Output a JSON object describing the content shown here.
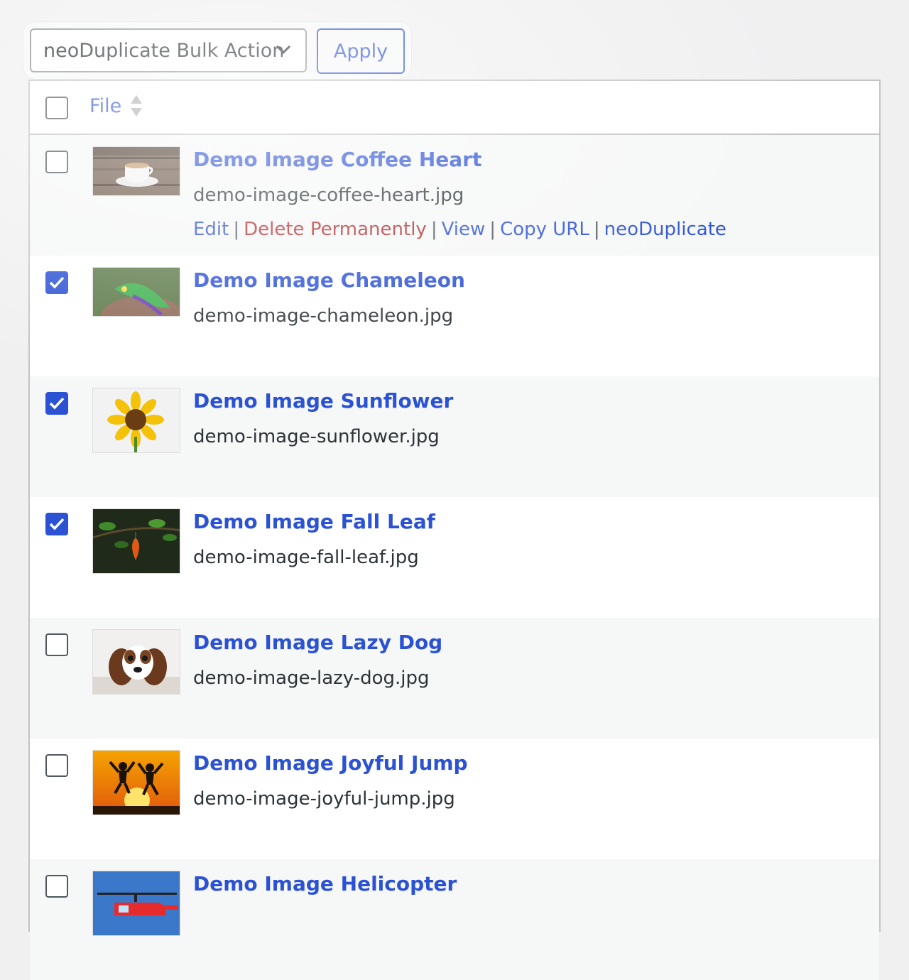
{
  "toolbar": {
    "bulk_action_selected": "neoDuplicate Bulk Action",
    "apply_label": "Apply"
  },
  "table": {
    "header": {
      "file_label": "File"
    },
    "rows": [
      {
        "title": "Demo Image Coffee Heart",
        "filename": "demo-image-coffee-heart.jpg",
        "checked": false,
        "actions": {
          "edit": "Edit",
          "delete": "Delete Permanently",
          "view": "View",
          "copy_url": "Copy URL",
          "duplicate": "neoDuplicate"
        }
      },
      {
        "title": "Demo Image Chameleon",
        "filename": "demo-image-chameleon.jpg",
        "checked": true
      },
      {
        "title": "Demo Image Sunflower",
        "filename": "demo-image-sunflower.jpg",
        "checked": true
      },
      {
        "title": "Demo Image Fall Leaf",
        "filename": "demo-image-fall-leaf.jpg",
        "checked": true
      },
      {
        "title": "Demo Image Lazy Dog",
        "filename": "demo-image-lazy-dog.jpg",
        "checked": false
      },
      {
        "title": "Demo Image Joyful Jump",
        "filename": "demo-image-joyful-jump.jpg",
        "checked": false
      },
      {
        "title": "Demo Image Helicopter",
        "filename": "",
        "checked": false
      }
    ]
  },
  "colors": {
    "link": "#2c52d4",
    "delete": "#b32d2e",
    "border": "#c3c4c7",
    "row_alt": "#f6f7f7"
  }
}
